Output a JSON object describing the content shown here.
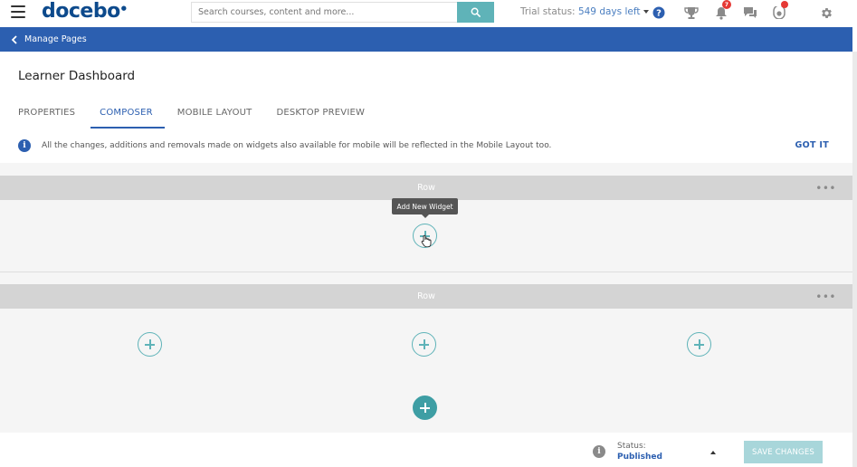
{
  "header": {
    "logo": "docebo",
    "search_placeholder": "Search courses, content and more...",
    "trial_label": "Trial status: ",
    "trial_days": "549 days left",
    "notifications_count": "7",
    "accent_color": "#5fb3b8"
  },
  "nav": {
    "back_label": "Manage Pages"
  },
  "page": {
    "title": "Learner Dashboard",
    "tabs": [
      {
        "label": "PROPERTIES"
      },
      {
        "label": "COMPOSER"
      },
      {
        "label": "MOBILE LAYOUT"
      },
      {
        "label": "DESKTOP PREVIEW"
      }
    ],
    "active_tab": "COMPOSER",
    "info_message": "All the changes, additions and removals made on widgets also available for mobile will be reflected in the Mobile Layout too.",
    "info_action": "GOT IT"
  },
  "composer": {
    "rows": [
      {
        "label": "Row",
        "menu": "•••"
      },
      {
        "label": "Row",
        "menu": "•••"
      }
    ],
    "tooltip": "Add New Widget"
  },
  "footer": {
    "status_label": "Status:",
    "status_value": "Published",
    "save_label": "SAVE CHANGES"
  },
  "colors": {
    "brand_blue": "#2c5fb0",
    "teal": "#5fb3b8",
    "badge_red": "#e53935"
  }
}
